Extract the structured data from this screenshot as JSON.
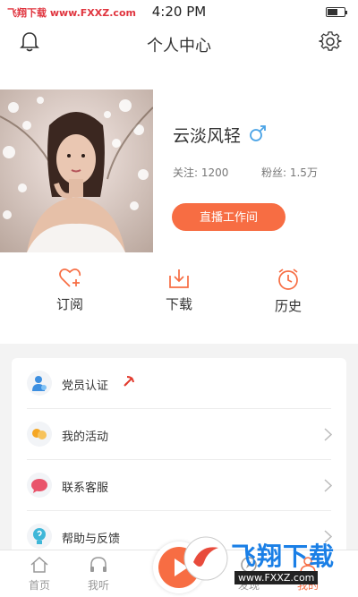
{
  "status_bar": {
    "carrier": "飞翔下载 www.FXXZ.com",
    "time": "4:20 PM",
    "battery_level": 0.55
  },
  "header": {
    "title": "个人中心",
    "left_icon": "bell-icon",
    "right_icon": "gear-icon"
  },
  "profile": {
    "username": "云淡风轻",
    "gender_icon": "male-symbol-icon",
    "follow_label": "关注: 1200",
    "fans_label": "粉丝: 1.5万",
    "live_button": "直播工作间",
    "accent_color": "#f76d43"
  },
  "actions": [
    {
      "label": "订阅",
      "icon": "heart-plus-icon"
    },
    {
      "label": "下载",
      "icon": "download-icon"
    },
    {
      "label": "历史",
      "icon": "clock-icon"
    }
  ],
  "menu": [
    {
      "label": "党员认证",
      "icon": "party-member-icon"
    },
    {
      "label": "我的活动",
      "icon": "activity-icon"
    },
    {
      "label": "联系客服",
      "icon": "customer-service-icon"
    },
    {
      "label": "帮助与反馈",
      "icon": "help-icon"
    }
  ],
  "tabbar": {
    "tabs": [
      {
        "label": "首页",
        "icon": "home-icon"
      },
      {
        "label": "我听",
        "icon": "headphones-icon"
      },
      {
        "label": "发现",
        "icon": "discover-icon"
      },
      {
        "label": "我的",
        "icon": "profile-icon"
      }
    ],
    "active_tab": "我的"
  },
  "watermark": {
    "main": "飞翔下载",
    "sub": "www.FXXZ.com"
  }
}
